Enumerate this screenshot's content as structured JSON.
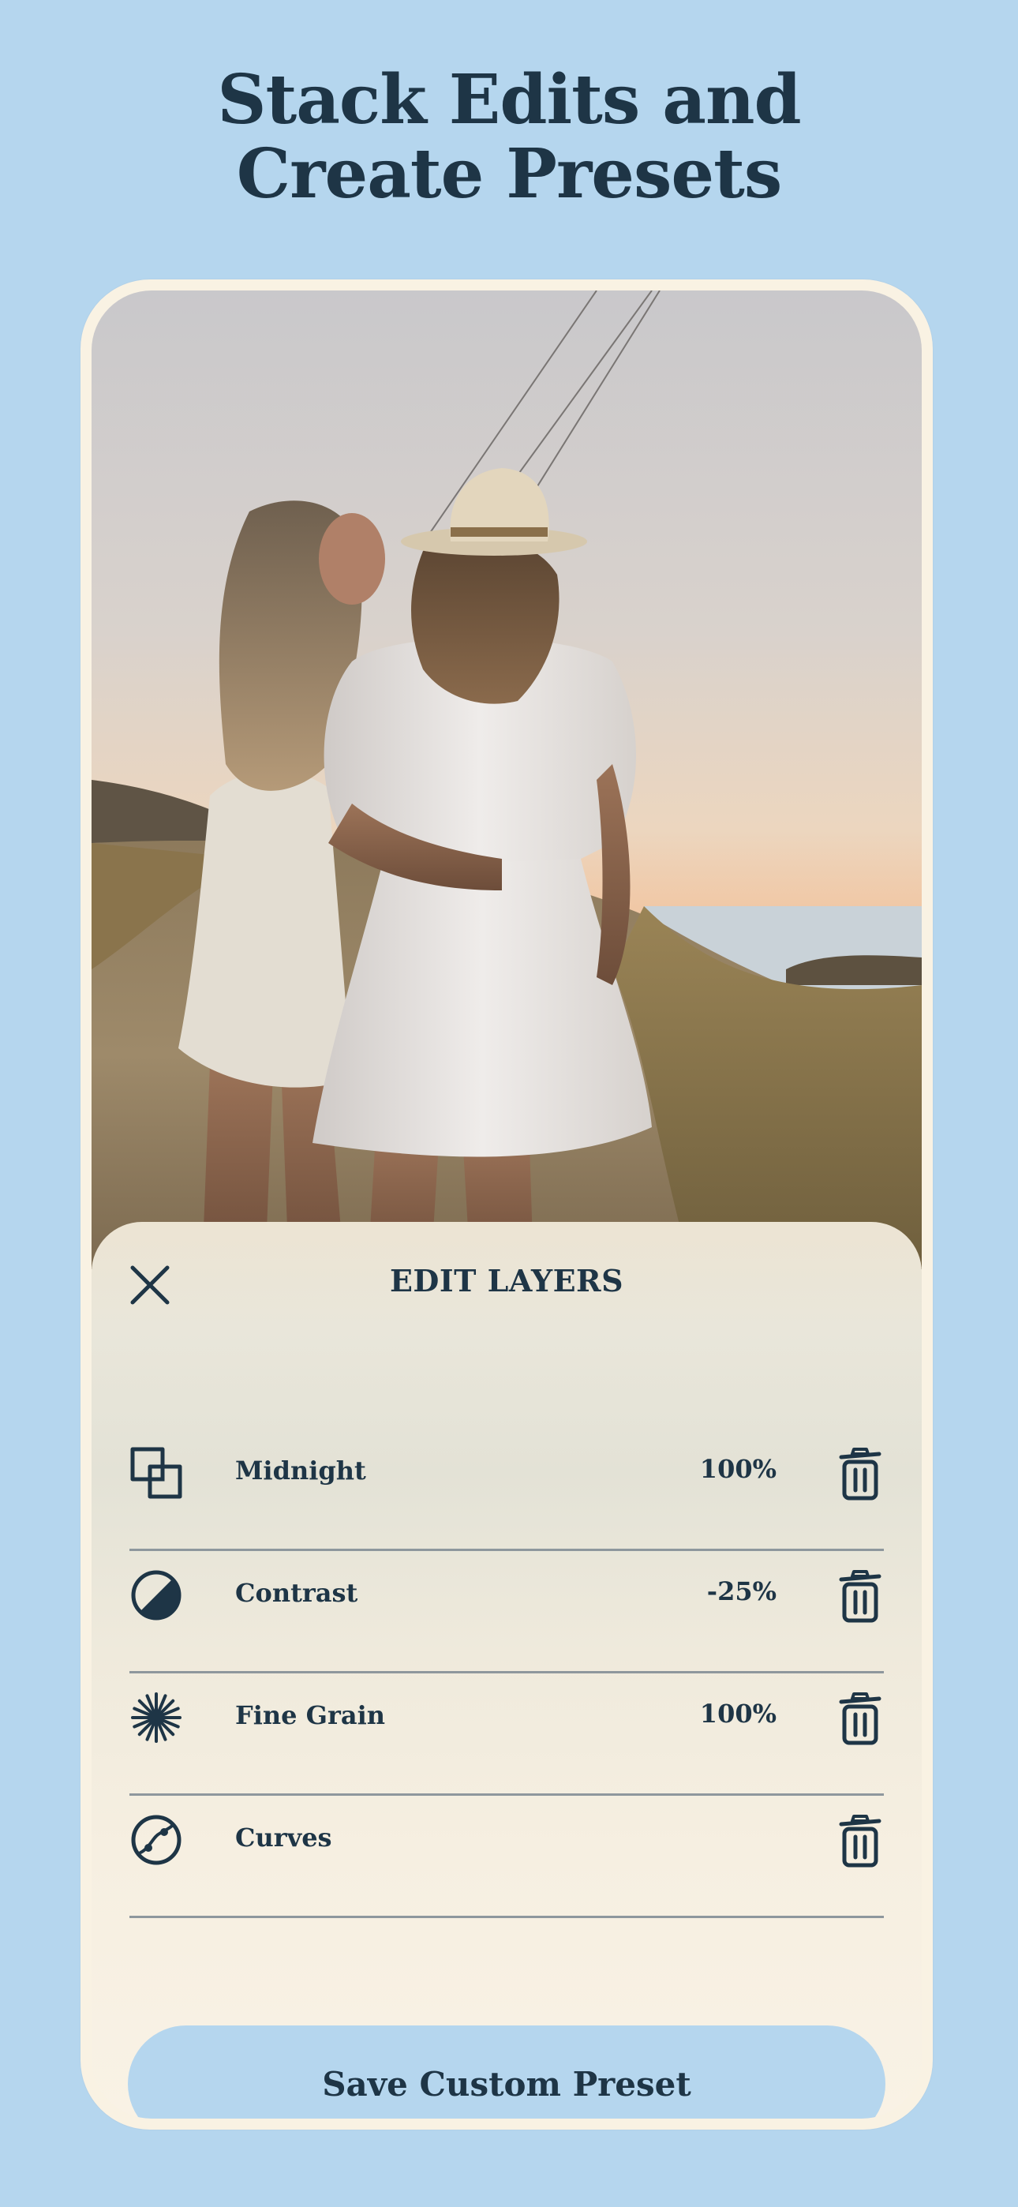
{
  "headline": {
    "line1": "Stack Edits and",
    "line2": "Create Presets"
  },
  "colors": {
    "background": "#b5d6ee",
    "text": "#1e3546",
    "panel": "#f9f2e3",
    "button": "#b5d6ee"
  },
  "photo": {
    "description_icon": "photo-preview"
  },
  "sheet": {
    "title": "EDIT LAYERS",
    "close_icon": "close-icon",
    "layers": [
      {
        "icon": "overlap-squares-icon",
        "name": "Midnight",
        "value": "100%"
      },
      {
        "icon": "half-circle-contrast-icon",
        "name": "Contrast",
        "value": "-25%"
      },
      {
        "icon": "grain-burst-icon",
        "name": "Fine Grain",
        "value": "100%"
      },
      {
        "icon": "curves-icon",
        "name": "Curves",
        "value": ""
      }
    ],
    "save_label": "Save Custom Preset"
  }
}
